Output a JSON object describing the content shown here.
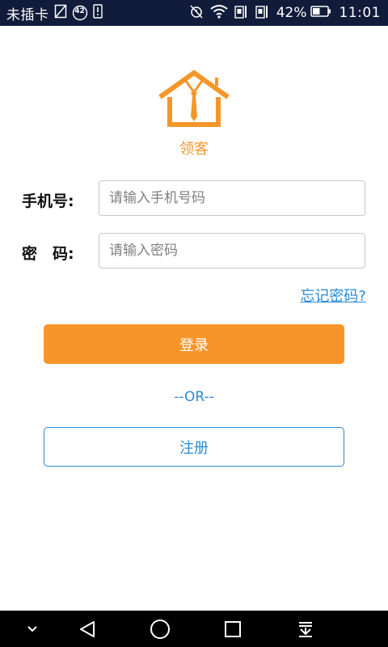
{
  "status_bar": {
    "carrier": "未插卡",
    "notification_badge": "42",
    "battery_percent": "42%",
    "time": "11:01",
    "icons": [
      "no-sim-icon",
      "notification-badge-icon",
      "alert-icon",
      "alarm-off-icon",
      "wifi-icon",
      "data-transfer-icon",
      "signal-icon",
      "battery-icon"
    ]
  },
  "app": {
    "name": "领客",
    "accent_color": "#f5962a",
    "link_color": "#2a8bd6"
  },
  "login_form": {
    "phone_label": "手机号:",
    "phone_placeholder": "请输入手机号码",
    "phone_value": "",
    "password_label": "密　码:",
    "password_placeholder": "请输入密码",
    "password_value": "",
    "forgot_password": "忘记密码?",
    "login_button": "登录",
    "or_divider": "--OR--",
    "register_button": "注册"
  },
  "nav_bar": {
    "icons": [
      "hide-keyboard-icon",
      "back-icon",
      "home-icon",
      "recents-icon",
      "notification-pull-icon"
    ]
  }
}
